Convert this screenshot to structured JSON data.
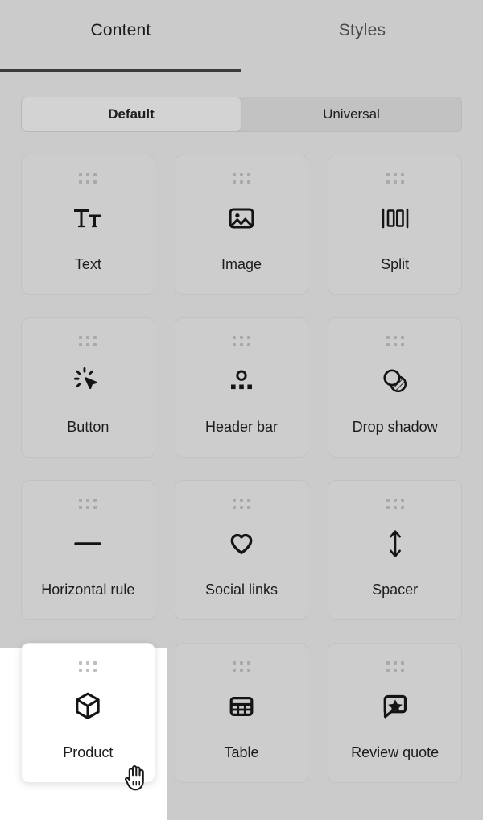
{
  "tabs": [
    {
      "label": "Content",
      "active": true
    },
    {
      "label": "Styles",
      "active": false
    }
  ],
  "segmented": {
    "options": [
      {
        "label": "Default",
        "selected": true
      },
      {
        "label": "Universal",
        "selected": false
      }
    ]
  },
  "blocks": [
    {
      "label": "Text",
      "icon": "text-icon",
      "selected": false
    },
    {
      "label": "Image",
      "icon": "image-icon",
      "selected": false
    },
    {
      "label": "Split",
      "icon": "split-icon",
      "selected": false
    },
    {
      "label": "Button",
      "icon": "cursor-click-icon",
      "selected": false
    },
    {
      "label": "Header bar",
      "icon": "header-bar-icon",
      "selected": false
    },
    {
      "label": "Drop shadow",
      "icon": "drop-shadow-icon",
      "selected": false
    },
    {
      "label": "Horizontal rule",
      "icon": "minus-icon",
      "selected": false
    },
    {
      "label": "Social links",
      "icon": "heart-icon",
      "selected": false
    },
    {
      "label": "Spacer",
      "icon": "arrows-vertical-icon",
      "selected": false
    },
    {
      "label": "Product",
      "icon": "cube-icon",
      "selected": true
    },
    {
      "label": "Table",
      "icon": "table-icon",
      "selected": false
    },
    {
      "label": "Review quote",
      "icon": "star-bubble-icon",
      "selected": false
    }
  ],
  "cursor": {
    "icon": "grab-hand-cursor"
  },
  "colors": {
    "background": "#cbcbcb",
    "card": "#cdcdcd",
    "selected_card": "#ffffff",
    "active_tab_underline": "#3b3b3b",
    "icon": "#141414",
    "handle_dot": "#a8a8a8"
  }
}
